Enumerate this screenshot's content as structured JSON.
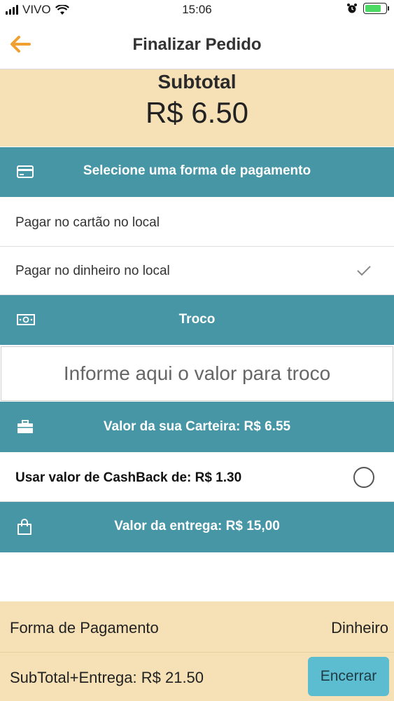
{
  "status_bar": {
    "carrier": "VIVO",
    "time": "15:06"
  },
  "nav": {
    "title": "Finalizar Pedido"
  },
  "subtotal": {
    "label": "Subtotal",
    "value": "R$ 6.50"
  },
  "payment": {
    "header": "Selecione uma forma de pagamento",
    "options": [
      {
        "label": "Pagar no cartão no local",
        "selected": false
      },
      {
        "label": "Pagar no dinheiro no local",
        "selected": true
      }
    ]
  },
  "troco": {
    "header": "Troco",
    "placeholder": "Informe aqui o valor para troco"
  },
  "wallet": {
    "header": "Valor da sua Carteira: R$ 6.55"
  },
  "cashback": {
    "label": "Usar valor de CashBack de: R$ 1.30",
    "checked": false
  },
  "delivery": {
    "header": "Valor da entrega: R$ 15,00"
  },
  "footer": {
    "payment_label": "Forma de Pagamento",
    "payment_value": "Dinheiro",
    "total_label": "SubTotal+Entrega: R$ 21.50",
    "close_button": "Encerrar"
  },
  "colors": {
    "accent": "#4696a6",
    "highlight": "#f6e1b7",
    "back_arrow": "#f0a030",
    "button": "#5dbdd0"
  }
}
